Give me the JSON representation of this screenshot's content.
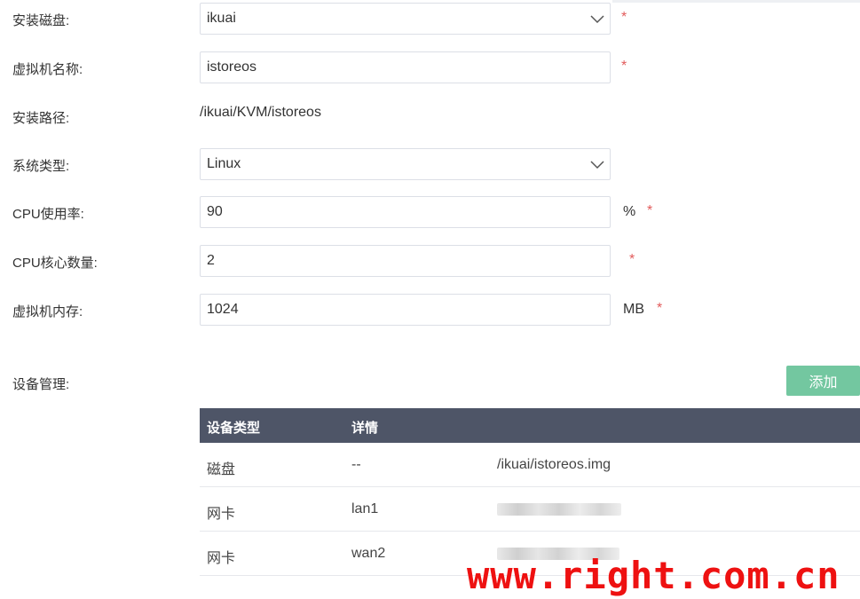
{
  "form": {
    "disk": {
      "label": "安装磁盘:",
      "value": "ikuai",
      "required": "*"
    },
    "vm_name": {
      "label": "虚拟机名称:",
      "value": "istoreos",
      "required": "*"
    },
    "install_path": {
      "label": "安装路径:",
      "value": "/ikuai/KVM/istoreos"
    },
    "os_type": {
      "label": "系统类型:",
      "value": "Linux"
    },
    "cpu_usage": {
      "label": "CPU使用率:",
      "value": "90",
      "unit": "%",
      "required": "*"
    },
    "cpu_cores": {
      "label": "CPU核心数量:",
      "value": "2",
      "required": "*"
    },
    "memory": {
      "label": "虚拟机内存:",
      "value": "1024",
      "unit": "MB",
      "required": "*"
    }
  },
  "devices": {
    "label": "设备管理:",
    "add_label": "添加",
    "columns": [
      "设备类型",
      "详情"
    ],
    "rows": [
      {
        "type": "磁盘",
        "detail": "--",
        "extra": "/ikuai/istoreos.img"
      },
      {
        "type": "网卡",
        "detail": "lan1",
        "extra": ""
      },
      {
        "type": "网卡",
        "detail": "wan2",
        "extra": ""
      }
    ]
  },
  "watermark": "www.right.com.cn",
  "colors": {
    "header_bg": "#4e5567",
    "add_button": "#73c7a0",
    "required": "#e25b5b",
    "watermark": "#ee1111"
  }
}
